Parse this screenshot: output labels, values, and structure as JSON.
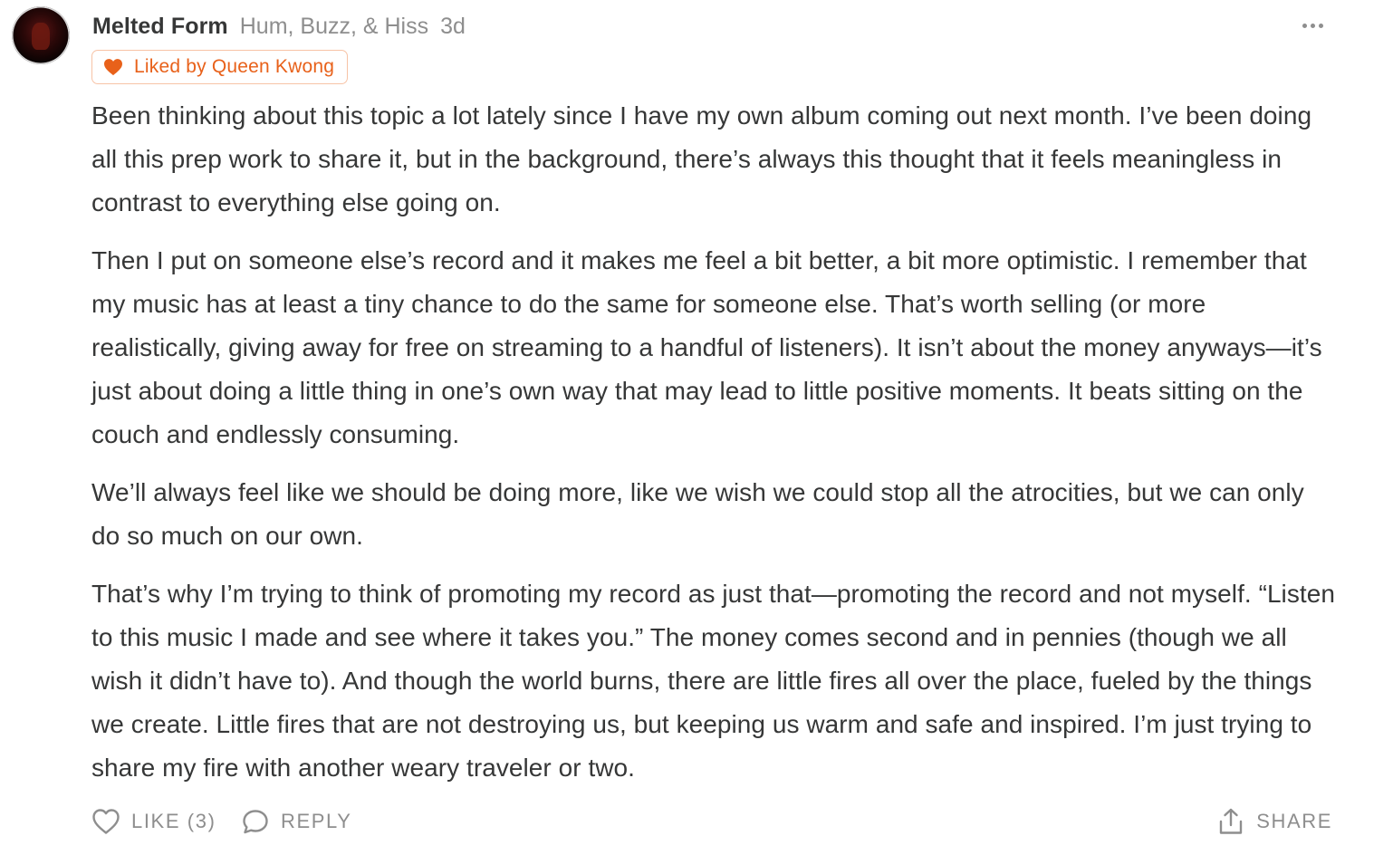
{
  "comment": {
    "author": "Melted Form",
    "publication": "Hum, Buzz, & Hiss",
    "time_ago": "3d",
    "liked_by": "Liked by Queen Kwong",
    "paragraphs": [
      "Been thinking about this topic a lot lately since I have my own album coming out next month. I’ve been doing all this prep work to share it, but in the background, there’s always this thought that it feels meaningless in contrast to everything else going on.",
      "Then I put on someone else’s record and it makes me feel a bit better, a bit more optimistic. I remember that my music has at least a tiny chance to do the same for someone else. That’s worth selling (or more realistically, giving away for free on streaming to a handful of listeners). It isn’t about the money anyways—it’s just about doing a little thing in one’s own way that may lead to little positive moments. It beats sitting on the couch and endlessly consuming.",
      "We’ll always feel like we should be doing more, like we wish we could stop all the atrocities, but we can only do so much on our own.",
      "That’s why I’m trying to think of promoting my record as just that—promoting the record and not myself. “Listen to this music I made and see where it takes you.” The money comes second and in pennies (though we all wish it didn’t have to). And though the world burns, there are little fires all over the place, fueled by the things we create. Little fires that are not destroying us, but keeping us warm and safe and inspired. I’m just trying to share my fire with another weary traveler or two."
    ]
  },
  "actions": {
    "like_label": "LIKE (3)",
    "reply_label": "REPLY",
    "share_label": "SHARE"
  },
  "icons": {
    "avatar": "avatar-image",
    "more": "more-options-icon",
    "liked": "heart-filled-icon",
    "like": "heart-outline-icon",
    "reply": "speech-bubble-icon",
    "share": "share-upload-icon"
  },
  "colors": {
    "text": "#363737",
    "muted": "#8e8e8e",
    "accent": "#e8611a",
    "badge_border": "#f7c3a6"
  }
}
